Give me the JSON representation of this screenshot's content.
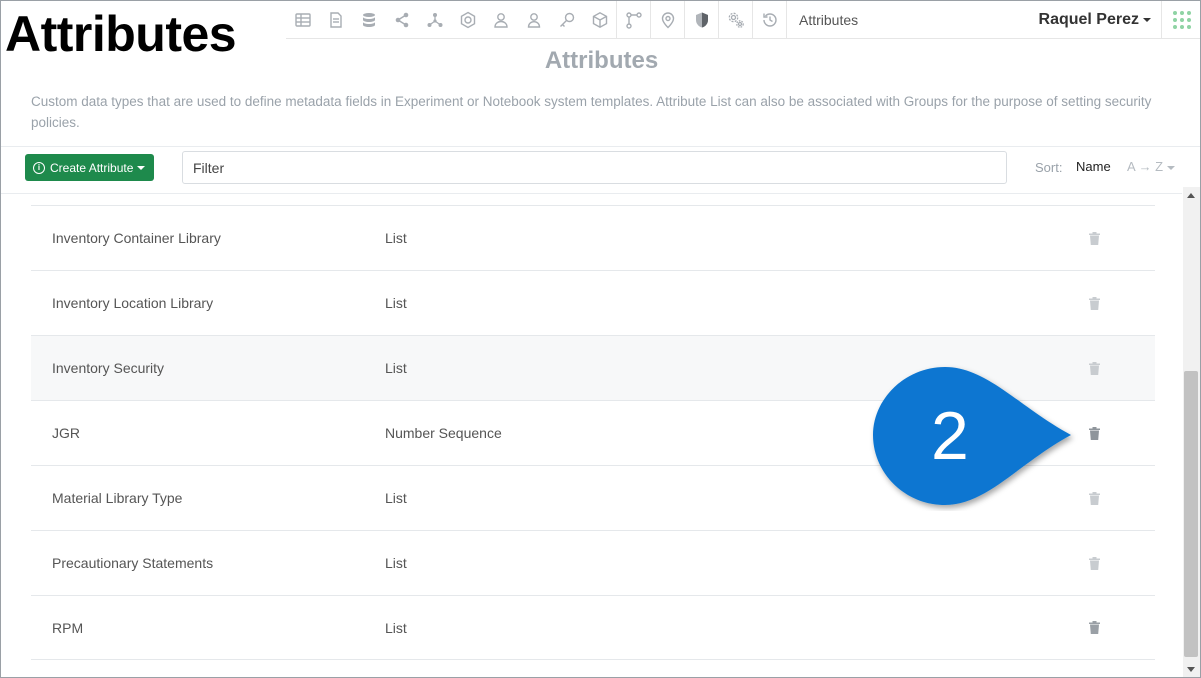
{
  "overlay": {
    "title": "Attributes"
  },
  "navbar": {
    "icons": [
      "table-icon",
      "document-icon",
      "database-icon",
      "share-icon",
      "network-icon",
      "badge-icon",
      "users-icon",
      "user-icon",
      "key-icon",
      "cube-icon",
      "workflow-icon",
      "location-icon",
      "shield-icon",
      "settings-icon",
      "history-icon"
    ],
    "breadcrumb": "Attributes",
    "user_name": "Raquel Perez",
    "accent_color": "#1e8a4c"
  },
  "header": {
    "title": "Attributes",
    "description": "Custom data types that are used to define metadata fields in Experiment or Notebook system templates. Attribute List can also be associated with Groups for the purpose of setting security policies."
  },
  "toolbar": {
    "create_label": "Create Attribute",
    "filter_placeholder": "Filter",
    "sort_label": "Sort:",
    "sort_field": "Name",
    "sort_direction": "A → Z"
  },
  "rows": [
    {
      "name": "Inventory Container Library",
      "type": "List"
    },
    {
      "name": "Inventory Location Library",
      "type": "List"
    },
    {
      "name": "Inventory Security",
      "type": "List"
    },
    {
      "name": "JGR",
      "type": "Number Sequence"
    },
    {
      "name": "Material Library Type",
      "type": "List"
    },
    {
      "name": "Precautionary Statements",
      "type": "List"
    },
    {
      "name": "RPM",
      "type": "List"
    }
  ],
  "callout": {
    "number": "2",
    "color": "#0a76d1"
  }
}
